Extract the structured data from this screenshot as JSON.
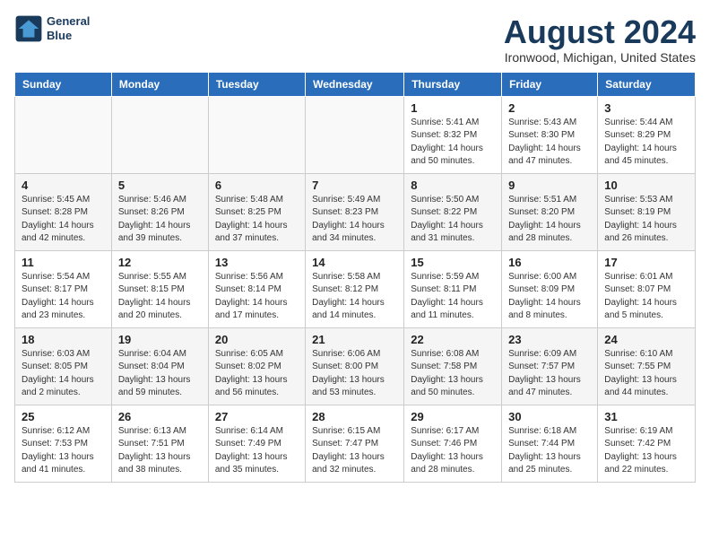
{
  "header": {
    "logo_line1": "General",
    "logo_line2": "Blue",
    "title": "August 2024",
    "subtitle": "Ironwood, Michigan, United States"
  },
  "days_of_week": [
    "Sunday",
    "Monday",
    "Tuesday",
    "Wednesday",
    "Thursday",
    "Friday",
    "Saturday"
  ],
  "weeks": [
    [
      {
        "num": "",
        "info": ""
      },
      {
        "num": "",
        "info": ""
      },
      {
        "num": "",
        "info": ""
      },
      {
        "num": "",
        "info": ""
      },
      {
        "num": "1",
        "info": "Sunrise: 5:41 AM\nSunset: 8:32 PM\nDaylight: 14 hours\nand 50 minutes."
      },
      {
        "num": "2",
        "info": "Sunrise: 5:43 AM\nSunset: 8:30 PM\nDaylight: 14 hours\nand 47 minutes."
      },
      {
        "num": "3",
        "info": "Sunrise: 5:44 AM\nSunset: 8:29 PM\nDaylight: 14 hours\nand 45 minutes."
      }
    ],
    [
      {
        "num": "4",
        "info": "Sunrise: 5:45 AM\nSunset: 8:28 PM\nDaylight: 14 hours\nand 42 minutes."
      },
      {
        "num": "5",
        "info": "Sunrise: 5:46 AM\nSunset: 8:26 PM\nDaylight: 14 hours\nand 39 minutes."
      },
      {
        "num": "6",
        "info": "Sunrise: 5:48 AM\nSunset: 8:25 PM\nDaylight: 14 hours\nand 37 minutes."
      },
      {
        "num": "7",
        "info": "Sunrise: 5:49 AM\nSunset: 8:23 PM\nDaylight: 14 hours\nand 34 minutes."
      },
      {
        "num": "8",
        "info": "Sunrise: 5:50 AM\nSunset: 8:22 PM\nDaylight: 14 hours\nand 31 minutes."
      },
      {
        "num": "9",
        "info": "Sunrise: 5:51 AM\nSunset: 8:20 PM\nDaylight: 14 hours\nand 28 minutes."
      },
      {
        "num": "10",
        "info": "Sunrise: 5:53 AM\nSunset: 8:19 PM\nDaylight: 14 hours\nand 26 minutes."
      }
    ],
    [
      {
        "num": "11",
        "info": "Sunrise: 5:54 AM\nSunset: 8:17 PM\nDaylight: 14 hours\nand 23 minutes."
      },
      {
        "num": "12",
        "info": "Sunrise: 5:55 AM\nSunset: 8:15 PM\nDaylight: 14 hours\nand 20 minutes."
      },
      {
        "num": "13",
        "info": "Sunrise: 5:56 AM\nSunset: 8:14 PM\nDaylight: 14 hours\nand 17 minutes."
      },
      {
        "num": "14",
        "info": "Sunrise: 5:58 AM\nSunset: 8:12 PM\nDaylight: 14 hours\nand 14 minutes."
      },
      {
        "num": "15",
        "info": "Sunrise: 5:59 AM\nSunset: 8:11 PM\nDaylight: 14 hours\nand 11 minutes."
      },
      {
        "num": "16",
        "info": "Sunrise: 6:00 AM\nSunset: 8:09 PM\nDaylight: 14 hours\nand 8 minutes."
      },
      {
        "num": "17",
        "info": "Sunrise: 6:01 AM\nSunset: 8:07 PM\nDaylight: 14 hours\nand 5 minutes."
      }
    ],
    [
      {
        "num": "18",
        "info": "Sunrise: 6:03 AM\nSunset: 8:05 PM\nDaylight: 14 hours\nand 2 minutes."
      },
      {
        "num": "19",
        "info": "Sunrise: 6:04 AM\nSunset: 8:04 PM\nDaylight: 13 hours\nand 59 minutes."
      },
      {
        "num": "20",
        "info": "Sunrise: 6:05 AM\nSunset: 8:02 PM\nDaylight: 13 hours\nand 56 minutes."
      },
      {
        "num": "21",
        "info": "Sunrise: 6:06 AM\nSunset: 8:00 PM\nDaylight: 13 hours\nand 53 minutes."
      },
      {
        "num": "22",
        "info": "Sunrise: 6:08 AM\nSunset: 7:58 PM\nDaylight: 13 hours\nand 50 minutes."
      },
      {
        "num": "23",
        "info": "Sunrise: 6:09 AM\nSunset: 7:57 PM\nDaylight: 13 hours\nand 47 minutes."
      },
      {
        "num": "24",
        "info": "Sunrise: 6:10 AM\nSunset: 7:55 PM\nDaylight: 13 hours\nand 44 minutes."
      }
    ],
    [
      {
        "num": "25",
        "info": "Sunrise: 6:12 AM\nSunset: 7:53 PM\nDaylight: 13 hours\nand 41 minutes."
      },
      {
        "num": "26",
        "info": "Sunrise: 6:13 AM\nSunset: 7:51 PM\nDaylight: 13 hours\nand 38 minutes."
      },
      {
        "num": "27",
        "info": "Sunrise: 6:14 AM\nSunset: 7:49 PM\nDaylight: 13 hours\nand 35 minutes."
      },
      {
        "num": "28",
        "info": "Sunrise: 6:15 AM\nSunset: 7:47 PM\nDaylight: 13 hours\nand 32 minutes."
      },
      {
        "num": "29",
        "info": "Sunrise: 6:17 AM\nSunset: 7:46 PM\nDaylight: 13 hours\nand 28 minutes."
      },
      {
        "num": "30",
        "info": "Sunrise: 6:18 AM\nSunset: 7:44 PM\nDaylight: 13 hours\nand 25 minutes."
      },
      {
        "num": "31",
        "info": "Sunrise: 6:19 AM\nSunset: 7:42 PM\nDaylight: 13 hours\nand 22 minutes."
      }
    ]
  ]
}
